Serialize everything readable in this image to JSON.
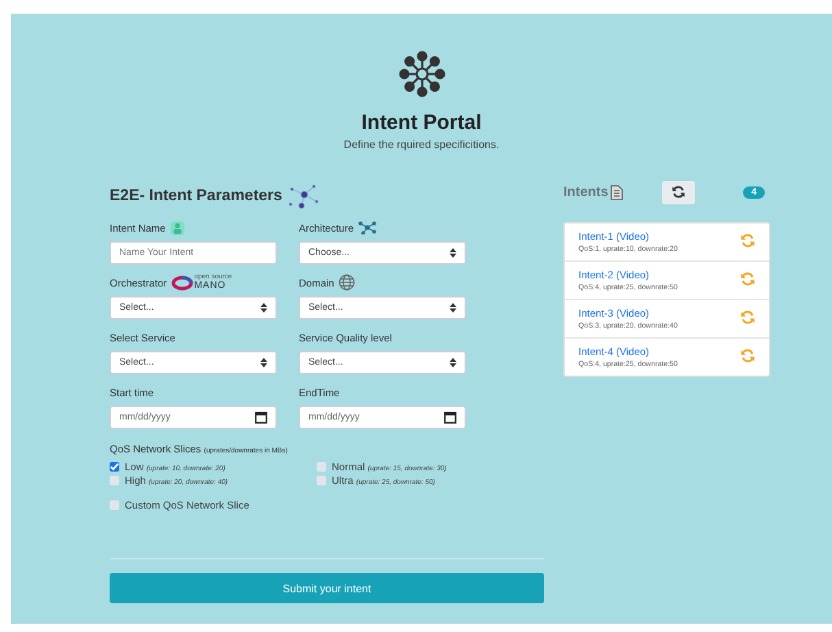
{
  "header": {
    "title": "Intent Portal",
    "subtitle": "Define the rquired specificitions."
  },
  "form": {
    "title": "E2E- Intent Parameters",
    "fields": [
      {
        "label": "Intent Name",
        "kind": "text",
        "placeholder": "Name Your Intent"
      },
      {
        "label": "Architecture",
        "kind": "select",
        "value": "Choose..."
      },
      {
        "label": "Orchestrator",
        "kind": "select",
        "value": "Select...",
        "logo_small": "open source",
        "logo_text": "MANO"
      },
      {
        "label": "Domain",
        "kind": "select",
        "value": "Select..."
      },
      {
        "label": "Select Service",
        "kind": "select",
        "value": "Select..."
      },
      {
        "label": "Service Quality level",
        "kind": "select",
        "value": "Select..."
      },
      {
        "label": "Start time",
        "kind": "date",
        "placeholder": "mm/dd/yyyy"
      },
      {
        "label": "EndTime",
        "kind": "date",
        "placeholder": "mm/dd/yyyy"
      }
    ],
    "slices_label": "QoS Network Slices",
    "slices_note": "(uprates/downrates in MBs)",
    "slices": [
      {
        "label": "Low",
        "note": "(uprate: 10, downrate: 20)",
        "checked": true
      },
      {
        "label": "Normal",
        "note": "(uprate: 15, downrate: 30)",
        "checked": false
      },
      {
        "label": "High",
        "note": "(uprate: 20, downrate: 40)",
        "checked": false
      },
      {
        "label": "Ultra",
        "note": "(uprate: 25, downrate: 50)",
        "checked": false
      }
    ],
    "custom": {
      "label": "Custom QoS Network Slice",
      "checked": false
    },
    "submit": "Submit your intent"
  },
  "intents": {
    "title": "Intents",
    "count": "4",
    "items": [
      {
        "name": "Intent-1 (Video)",
        "detail": "QoS:1, uprate:10, downrate:20"
      },
      {
        "name": "Intent-2 (Video)",
        "detail": "QoS:4, uprate:25, downrate:50"
      },
      {
        "name": "Intent-3 (Video)",
        "detail": "QoS:3, uprate:20, downrate:40"
      },
      {
        "name": "Intent-4 (Video)",
        "detail": "QoS:4, uprate:25, downrate:50"
      }
    ]
  }
}
